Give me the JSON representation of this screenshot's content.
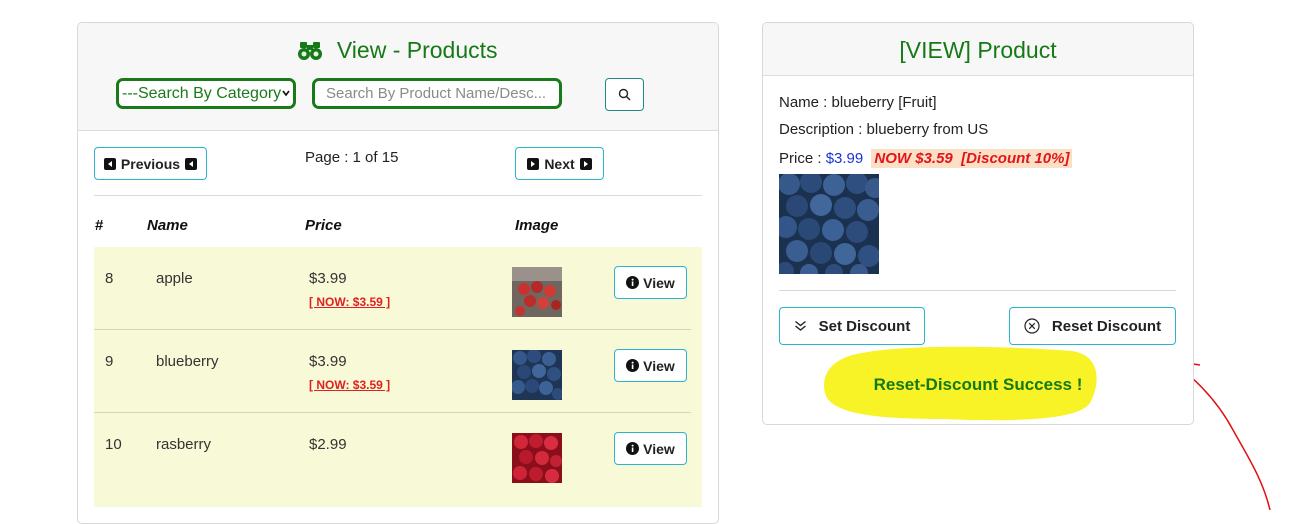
{
  "products_panel": {
    "title": "View - Products",
    "category_select": {
      "selected": "---Search By Category"
    },
    "search": {
      "placeholder": "Search By Product Name/Desc..."
    },
    "pagination": {
      "previous_label": "Previous",
      "next_label": "Next",
      "page_info": "Page : 1 of 15"
    },
    "table": {
      "headers": [
        "#",
        "Name",
        "Price",
        "Image"
      ],
      "rows": [
        {
          "num": "8",
          "name": "apple",
          "price": "$3.99",
          "now": "[ NOW: $3.59 ]",
          "view_label": "View",
          "image": "apple-photo"
        },
        {
          "num": "9",
          "name": "blueberry",
          "price": "$3.99",
          "now": "[ NOW: $3.59 ]",
          "view_label": "View",
          "image": "blueberry-photo"
        },
        {
          "num": "10",
          "name": "rasberry",
          "price": "$2.99",
          "now": "",
          "view_label": "View",
          "image": "rasberry-photo"
        }
      ]
    }
  },
  "detail_panel": {
    "title": "[VIEW] Product",
    "name_line": "Name : blueberry [Fruit]",
    "description_line": "Description : blueberry from US",
    "price_label": "Price : ",
    "price_value": "$3.99",
    "discount_text": "NOW $3.59  [Discount 10%]",
    "set_discount_label": "Set Discount",
    "reset_discount_label": "Reset Discount",
    "success_message": "Reset-Discount Success !"
  },
  "colors": {
    "accent_green": "#157a15",
    "button_border": "#2ab4cf",
    "row_highlight": "#f8f9d6",
    "discount_red": "#e3141b",
    "discount_bg": "#fbe0c6",
    "price_blue": "#1a33d6",
    "annotation_yellow": "#f7f21a",
    "annotation_red": "#e01010"
  },
  "icons": [
    "binoculars-icon",
    "chevron-down-icon",
    "search-icon",
    "caret-left-square-icon",
    "caret-right-square-icon",
    "info-circle-icon",
    "double-chevron-down-icon",
    "x-circle-icon"
  ]
}
